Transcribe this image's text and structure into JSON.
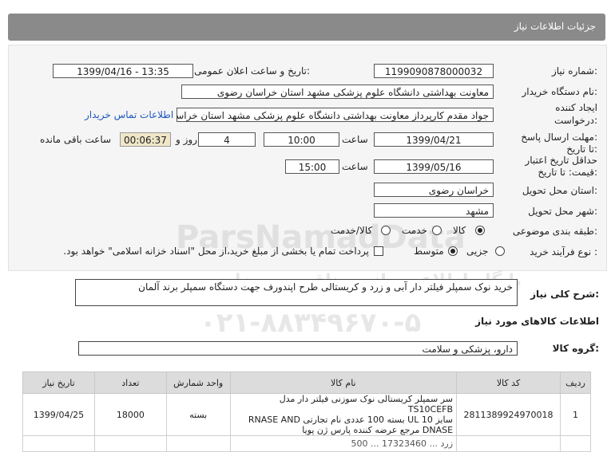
{
  "header": {
    "title": "جزئیات اطلاعات نیاز"
  },
  "form": {
    "need_number": {
      "label": "شماره نیاز:",
      "value": "1199090878000032"
    },
    "announce": {
      "label": "تاریخ و ساعت اعلان عمومی:",
      "value": "1399/04/16 - 13:35"
    },
    "buyer_org": {
      "label": "نام دستگاه خریدار:",
      "value": "معاونت بهداشتی دانشگاه علوم پزشکی مشهد استان خراسان رضوی"
    },
    "requester": {
      "label1": "ایجاد کننده",
      "label2": "درخواست:",
      "value": "جواد مقدم کارپرداز معاونت بهداشتی دانشگاه علوم پزشکی مشهد استان خراسان رضوی",
      "contact_link": "اطلاعات تماس خریدار"
    },
    "reply_deadline": {
      "label1": "مهلت ارسال پاسخ:",
      "label2": "تا تاریخ:",
      "date": "1399/04/21",
      "time_label": "ساعت",
      "time": "10:00",
      "days": "4",
      "days_label": "روز و",
      "remaining": "00:06:37",
      "remaining_label": "ساعت باقی مانده"
    },
    "price_validity": {
      "label1": "حداقل تاریخ اعتبار",
      "label2": "قیمت: تا تاریخ:",
      "date": "1399/05/16",
      "time_label": "ساعت",
      "time": "15:00"
    },
    "delivery_province": {
      "label": "استان محل تحویل:",
      "value": "خراسان رضوی"
    },
    "delivery_city": {
      "label": "شهر محل تحویل:",
      "value": "مشهد"
    },
    "category": {
      "label": "طبقه بندی موضوعی:",
      "options": [
        "کالا",
        "خدمت",
        "کالا/خدمت"
      ],
      "selected": "کالا"
    },
    "purchase_type": {
      "label": "نوع فرآیند خرید :",
      "options": [
        "جزیی",
        "متوسط"
      ],
      "selected": "متوسط",
      "check_text": "پرداخت تمام یا بخشی از مبلغ خرید،از محل \"اسناد خزانه اسلامی\" خواهد بود."
    }
  },
  "description": {
    "label": "شرح کلی نیاز:",
    "value": "خرید نوک سمپلر فیلتر دار آبی و زرد و کریستالی طرح اپندورف جهت دستگاه سمپلر برند آلمان"
  },
  "goods_info": {
    "title": "اطلاعات کالاهای مورد نیاز"
  },
  "goods_group": {
    "label": "گروه کالا:",
    "value": "دارو، پزشکی و سلامت"
  },
  "table": {
    "headers": {
      "row": "ردیف",
      "code": "کد کالا",
      "name": "نام کالا",
      "unit": "واحد شمارش",
      "qty": "تعداد",
      "date": "تاریخ نیاز"
    },
    "rows": [
      {
        "row": "1",
        "code": "2811389924970018",
        "name_lines": [
          "سر سمپلر کریستالی نوک سوزنی فیلتر دار مدل TS10CEFB",
          "سایز UL 10 بسته 100 عددی نام تجارتی RNASE AND",
          "DNASE مرجع عرضه کننده پارس ژن پویا"
        ],
        "unit": "بسته",
        "qty": "18000",
        "date": "1399/04/25"
      }
    ],
    "partial_row_fragment": "زرد ... 17323460 ... 500"
  },
  "watermark": {
    "brand": "ParsNamadData",
    "subtitle": "پایگاه اطلاع رسانی مناقصه و مزایده",
    "phone": "۰۲۱-۸۸۳۴۹۶۷۰-۵"
  }
}
